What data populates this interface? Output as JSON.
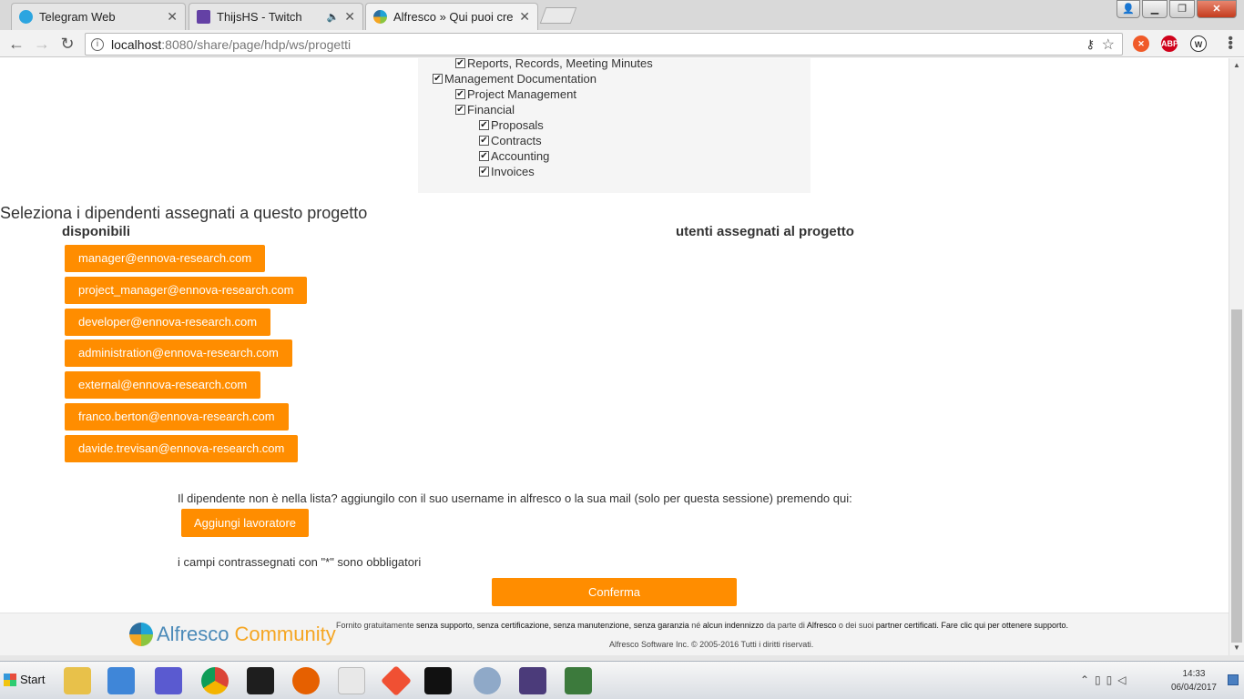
{
  "browser": {
    "tabs": [
      {
        "title": "Telegram Web",
        "icon": "telegram-icon",
        "color": "#2ca5e0"
      },
      {
        "title": "ThijsHS - Twitch",
        "icon": "twitch-icon",
        "color": "#6441a5"
      },
      {
        "title": "Alfresco » Qui puoi crear",
        "icon": "alfresco-icon",
        "color": "#8bc53f"
      }
    ],
    "url_host": "localhost",
    "url_rest": ":8080/share/page/hdp/ws/progetti"
  },
  "tree": [
    {
      "label": "Reports, Records, Meeting Minutes",
      "level": 1,
      "checked": true
    },
    {
      "label": "Management Documentation",
      "level": 0,
      "checked": true
    },
    {
      "label": "Project Management",
      "level": 1,
      "checked": true
    },
    {
      "label": "Financial",
      "level": 1,
      "checked": true
    },
    {
      "label": "Proposals",
      "level": 2,
      "checked": true
    },
    {
      "label": "Contracts",
      "level": 2,
      "checked": true
    },
    {
      "label": "Accounting",
      "level": 2,
      "checked": true
    },
    {
      "label": "Invoices",
      "level": 2,
      "checked": true
    }
  ],
  "assign": {
    "title": "Seleziona i dipendenti assegnati a questo progetto",
    "available_label": "disponibili",
    "assigned_label": "utenti assegnati al progetto",
    "employees": [
      "manager@ennova-research.com",
      "project_manager@ennova-research.com",
      "developer@ennova-research.com",
      "administration@ennova-research.com",
      "external@ennova-research.com",
      "franco.berton@ennova-research.com",
      "davide.trevisan@ennova-research.com"
    ]
  },
  "add_worker": {
    "hint": "Il dipendente non è nella lista? aggiungilo con il suo username in alfresco o la sua mail (solo per questa sessione) premendo qui:",
    "button": "Aggiungi lavoratore"
  },
  "required_note": "i campi contrassegnati con \"*\" sono obbligatori",
  "confirm_button": "Conferma",
  "footer": {
    "logo_alfresco": "Alfresco",
    "logo_community": "Community",
    "text_1": "Fornito gratuitamente ",
    "text_2": "senza supporto, senza certificazione, senza manutenzione, senza garanzia",
    "text_3": " né ",
    "text_4": "alcun indennizzo",
    "text_5": " da parte di ",
    "text_6": "Alfresco",
    "text_7": " o dei suoi ",
    "text_8": "partner certificati. Fare clic qui per ottenere supporto.",
    "copyright": "Alfresco Software Inc. © 2005-2016 Tutti i diritti riservati."
  },
  "taskbar": {
    "start": "Start",
    "time": "14:33",
    "date": "06/04/2017",
    "apps": [
      {
        "name": "explorer-icon",
        "color": "#e8c14a"
      },
      {
        "name": "media-player-icon",
        "color": "#3f86d8"
      },
      {
        "name": "putty-icon",
        "color": "#5a5ad0"
      },
      {
        "name": "chrome-icon",
        "color": "#db4437"
      },
      {
        "name": "intellij-icon",
        "color": "#1e1e1e"
      },
      {
        "name": "firefox-icon",
        "color": "#e66000"
      },
      {
        "name": "slack-icon",
        "color": "#e8e8e8"
      },
      {
        "name": "git-icon",
        "color": "#f05033"
      },
      {
        "name": "terminal-icon",
        "color": "#111111"
      },
      {
        "name": "settings-icon",
        "color": "#8fa9c8"
      },
      {
        "name": "java-ee-ide-icon",
        "color": "#4b3b7a"
      },
      {
        "name": "monitor-icon",
        "color": "#3c7a3c"
      }
    ]
  },
  "accent": "#ff8d00"
}
